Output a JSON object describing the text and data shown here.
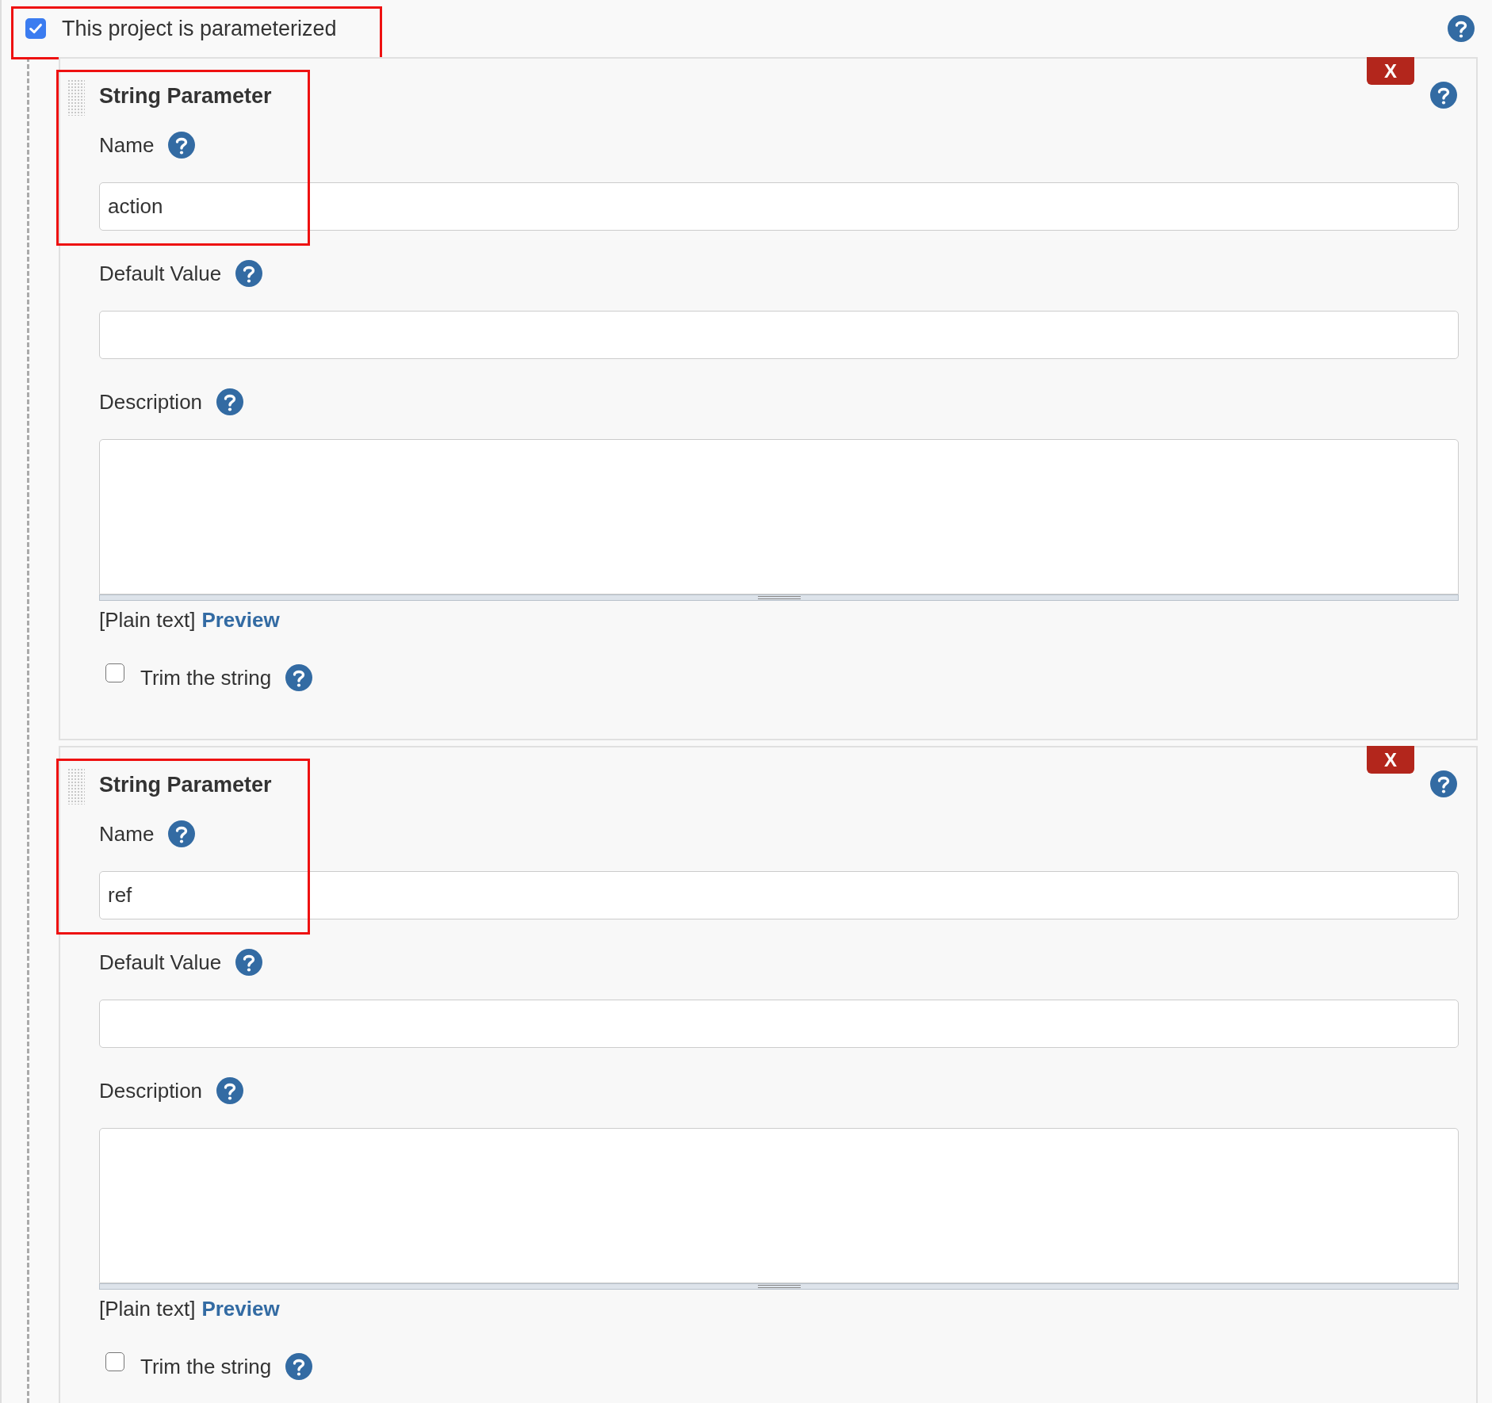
{
  "header": {
    "label": "This project is parameterized",
    "checked": true,
    "highlighted": true
  },
  "parameters": [
    {
      "title": "String Parameter",
      "highlighted": true,
      "delete_label": "X",
      "fields": [
        {
          "kind": "text",
          "label": "Name",
          "value": "action"
        },
        {
          "kind": "text",
          "label": "Default Value"
        },
        {
          "kind": "textarea",
          "label": "Description"
        }
      ],
      "format_note": "[Plain text]",
      "preview_link": "Preview",
      "trim": {
        "label": "Trim the string",
        "checked": false
      }
    },
    {
      "title": "String Parameter",
      "highlighted": true,
      "delete_label": "X",
      "fields": [
        {
          "kind": "text",
          "label": "Name",
          "value": "ref"
        },
        {
          "kind": "text",
          "label": "Default Value"
        },
        {
          "kind": "textarea",
          "label": "Description"
        }
      ],
      "format_note": "[Plain text]",
      "preview_link": "Preview",
      "trim": {
        "label": "Trim the string",
        "checked": false
      }
    }
  ]
}
